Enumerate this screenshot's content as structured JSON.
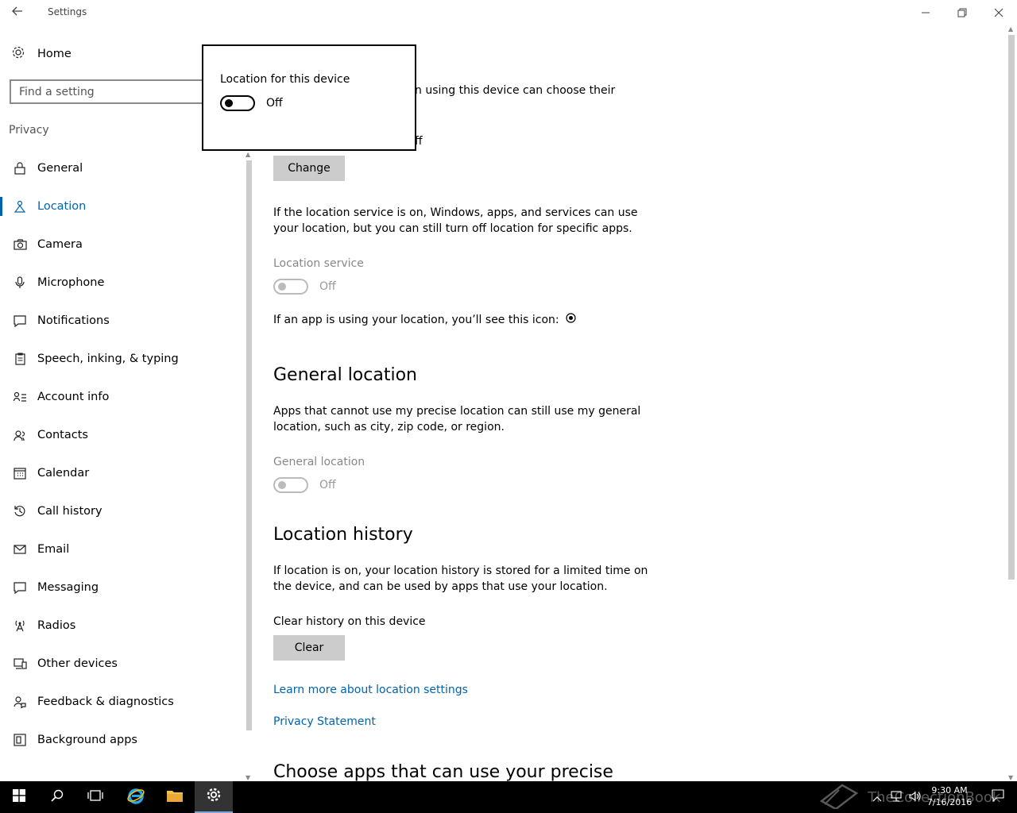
{
  "window": {
    "title": "Settings"
  },
  "sidebar": {
    "home_label": "Home",
    "search_placeholder": "Find a setting",
    "section_label": "Privacy",
    "items": [
      {
        "label": "General",
        "icon": "lock-icon"
      },
      {
        "label": "Location",
        "icon": "location-person-icon",
        "active": true
      },
      {
        "label": "Camera",
        "icon": "camera-icon"
      },
      {
        "label": "Microphone",
        "icon": "microphone-icon"
      },
      {
        "label": "Notifications",
        "icon": "notifications-icon"
      },
      {
        "label": "Speech, inking, & typing",
        "icon": "clipboard-icon"
      },
      {
        "label": "Account info",
        "icon": "account-info-icon"
      },
      {
        "label": "Contacts",
        "icon": "contacts-icon"
      },
      {
        "label": "Calendar",
        "icon": "calendar-icon"
      },
      {
        "label": "Call history",
        "icon": "history-icon"
      },
      {
        "label": "Email",
        "icon": "email-icon"
      },
      {
        "label": "Messaging",
        "icon": "messaging-icon"
      },
      {
        "label": "Radios",
        "icon": "radio-tower-icon"
      },
      {
        "label": "Other devices",
        "icon": "devices-icon"
      },
      {
        "label": "Feedback & diagnostics",
        "icon": "feedback-icon"
      },
      {
        "label": "Background apps",
        "icon": "background-apps-icon"
      }
    ]
  },
  "main": {
    "partial_line_1": "n using this device can choose their",
    "partial_line_2": "ff",
    "change_button": "Change",
    "service_desc_1": "If the location service is on, Windows, apps, and services can use",
    "service_desc_2": "your location, but you can still turn off location for specific apps.",
    "location_service_label": "Location service",
    "location_service_state": "Off",
    "icon_note": "If an app is using your location, you’ll see this icon:",
    "general_location_heading": "General location",
    "general_desc_1": "Apps that cannot use my precise location can still use my general",
    "general_desc_2": "location, such as city, zip code, or region.",
    "general_location_label": "General location",
    "general_location_state": "Off",
    "history_heading": "Location history",
    "history_desc_1": "If location is on, your location history is stored for a limited time on",
    "history_desc_2": "the device, and can be used by apps that use your location.",
    "clear_history_label": "Clear history on this device",
    "clear_button": "Clear",
    "learn_more_link": "Learn more about location settings",
    "privacy_link": "Privacy Statement",
    "choose_apps_heading": "Choose apps that can use your precise"
  },
  "flyout": {
    "title": "Location for this device",
    "state": "Off"
  },
  "taskbar": {
    "time": "9:30 AM",
    "date": "7/16/2016",
    "watermark": "TheCollectionBook"
  },
  "colors": {
    "accent": "#0063b1",
    "taskbar": "#000000"
  }
}
